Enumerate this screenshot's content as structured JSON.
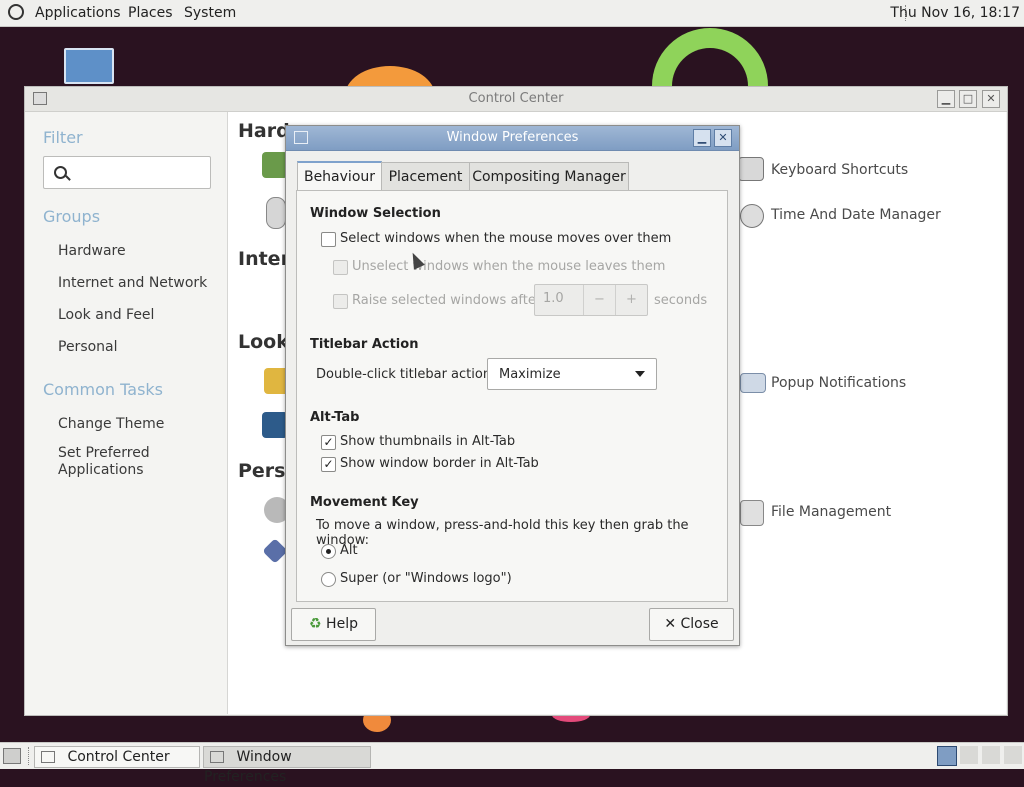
{
  "top_panel": {
    "menus": [
      "Applications",
      "Places",
      "System"
    ],
    "clock": "Thu Nov 16, 18:17"
  },
  "control_center": {
    "title": "Control Center",
    "filter_heading": "Filter",
    "groups_heading": "Groups",
    "groups": [
      "Hardware",
      "Internet and Network",
      "Look and Feel",
      "Personal"
    ],
    "common_tasks_heading": "Common Tasks",
    "tasks": [
      "Change Theme",
      "Set Preferred",
      "Applications"
    ],
    "sections": [
      "Hardw",
      "Intern",
      "Look",
      "Perso"
    ],
    "right_items": [
      "Keyboard Shortcuts",
      "Time And Date Manager",
      "Popup Notifications",
      "File Management"
    ]
  },
  "window_preferences": {
    "title": "Window Preferences",
    "tabs": [
      "Behaviour",
      "Placement",
      "Compositing Manager"
    ],
    "window_selection": {
      "heading": "Window Selection",
      "select_on_hover": "Select windows when the mouse moves over them",
      "select_on_hover_checked": false,
      "unselect_on_leave": "Unselect windows when the mouse leaves them",
      "raise_after": "Raise selected windows after",
      "raise_value": "1.0",
      "raise_unit": "seconds",
      "minus": "−",
      "plus": "+"
    },
    "titlebar_action": {
      "heading": "Titlebar Action",
      "label": "Double-click titlebar action:",
      "value": "Maximize"
    },
    "alt_tab": {
      "heading": "Alt-Tab",
      "show_thumbnails": "Show thumbnails in Alt-Tab",
      "show_thumbnails_checked": true,
      "show_border": "Show window border in Alt-Tab",
      "show_border_checked": true
    },
    "movement_key": {
      "heading": "Movement Key",
      "description": "To move a window, press-and-hold this key then grab the window:",
      "options": [
        "Alt",
        "Super (or \"Windows logo\")"
      ],
      "selected": "Alt"
    },
    "help_label": "Help",
    "close_label": "Close"
  },
  "taskbar": {
    "items": [
      "Control Center",
      "Window Preferences"
    ]
  },
  "colors": {
    "accent": "#7f9dc3",
    "desktop": "#2a1220"
  }
}
